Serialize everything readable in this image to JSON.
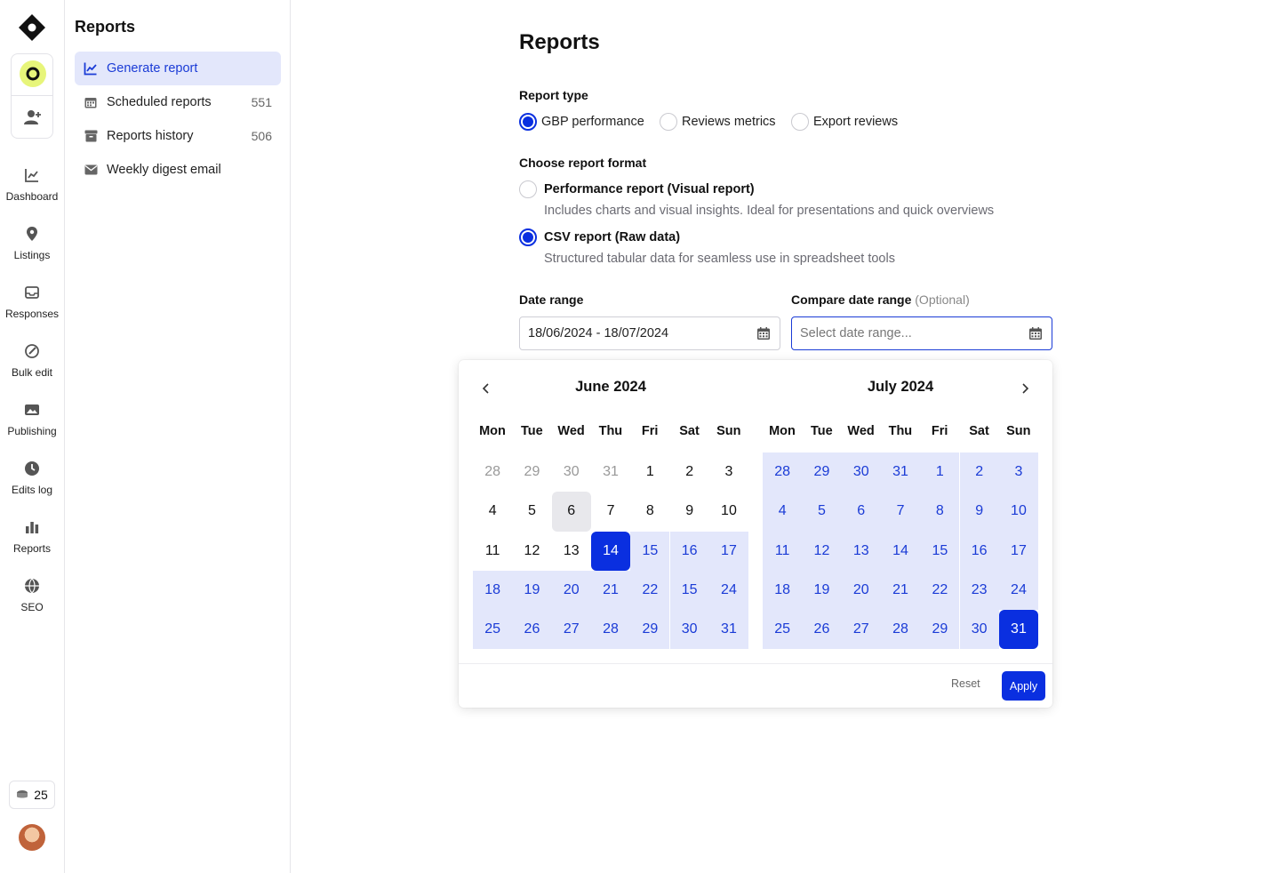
{
  "rail": {
    "items": [
      {
        "label": "Dashboard",
        "icon": "chart-line-icon"
      },
      {
        "label": "Listings",
        "icon": "map-pin-icon"
      },
      {
        "label": "Responses",
        "icon": "inbox-icon"
      },
      {
        "label": "Bulk edit",
        "icon": "bulk-edit-icon"
      },
      {
        "label": "Publishing",
        "icon": "images-icon"
      },
      {
        "label": "Edits log",
        "icon": "clock-icon"
      },
      {
        "label": "Reports",
        "icon": "bar-chart-icon"
      },
      {
        "label": "SEO",
        "icon": "globe-icon"
      }
    ],
    "credits": "25"
  },
  "subnav": {
    "title": "Reports",
    "items": [
      {
        "label": "Generate report",
        "count": "",
        "icon": "chart-line-icon"
      },
      {
        "label": "Scheduled reports",
        "count": "551",
        "icon": "calendar-icon"
      },
      {
        "label": "Reports history",
        "count": "506",
        "icon": "archive-icon"
      },
      {
        "label": "Weekly digest email",
        "count": "",
        "icon": "envelope-icon"
      }
    ]
  },
  "main": {
    "title": "Reports",
    "report_type_label": "Report type",
    "report_types": [
      "GBP performance",
      "Reviews metrics",
      "Export reviews"
    ],
    "selected_report_type": "GBP performance",
    "format_label": "Choose report format",
    "formats": [
      {
        "title": "Performance report (Visual report)",
        "desc": "Includes charts and visual insights. Ideal for presentations and quick overviews",
        "selected": false
      },
      {
        "title": "CSV report (Raw data)",
        "desc": "Structured tabular data for seamless use in spreadsheet tools",
        "selected": true
      }
    ],
    "date_range_label": "Date range",
    "date_range_value": "18/06/2024 - 18/07/2024",
    "compare_label": "Compare date range",
    "compare_optional": "(Optional)",
    "compare_placeholder": "Select date range..."
  },
  "calendar": {
    "weekdays": [
      "Mon",
      "Tue",
      "Wed",
      "Thu",
      "Fri",
      "Sat",
      "Sun"
    ],
    "months": [
      {
        "title": "June 2024",
        "days": [
          [
            "28",
            "29",
            "30",
            "31",
            "1",
            "2",
            "3"
          ],
          [
            "4",
            "5",
            "6",
            "7",
            "8",
            "9",
            "10"
          ],
          [
            "11",
            "12",
            "13",
            "14",
            "15",
            "16",
            "17"
          ],
          [
            "18",
            "19",
            "20",
            "21",
            "22",
            "15",
            "24"
          ],
          [
            "25",
            "26",
            "27",
            "28",
            "29",
            "30",
            "31"
          ]
        ],
        "states": [
          [
            "muted",
            "muted",
            "muted",
            "muted",
            "",
            "",
            ""
          ],
          [
            "",
            "",
            "today",
            "",
            "",
            "",
            ""
          ],
          [
            "",
            "",
            "",
            "sel",
            "inrange",
            "inrange",
            "inrange"
          ],
          [
            "inrange",
            "inrange",
            "inrange",
            "inrange",
            "inrange",
            "inrange",
            "inrange"
          ],
          [
            "inrange",
            "inrange",
            "inrange",
            "inrange",
            "inrange",
            "inrange",
            "inrange"
          ]
        ]
      },
      {
        "title": "July 2024",
        "days": [
          [
            "28",
            "29",
            "30",
            "31",
            "1",
            "2",
            "3"
          ],
          [
            "4",
            "5",
            "6",
            "7",
            "8",
            "9",
            "10"
          ],
          [
            "11",
            "12",
            "13",
            "14",
            "15",
            "16",
            "17"
          ],
          [
            "18",
            "19",
            "20",
            "21",
            "22",
            "23",
            "24"
          ],
          [
            "25",
            "26",
            "27",
            "28",
            "29",
            "30",
            "31"
          ]
        ],
        "states": [
          [
            "inrange",
            "inrange",
            "inrange",
            "inrange",
            "inrange",
            "inrange",
            "inrange"
          ],
          [
            "inrange",
            "inrange",
            "inrange",
            "inrange",
            "inrange",
            "inrange",
            "inrange"
          ],
          [
            "inrange",
            "inrange",
            "inrange",
            "inrange",
            "inrange",
            "inrange",
            "inrange"
          ],
          [
            "inrange",
            "inrange",
            "inrange",
            "inrange",
            "inrange",
            "inrange",
            "inrange"
          ],
          [
            "inrange",
            "inrange",
            "inrange",
            "inrange",
            "inrange",
            "inrange",
            "sel"
          ]
        ]
      }
    ],
    "reset_label": "Reset",
    "apply_label": "Apply"
  },
  "colors": {
    "accent": "#0a2fe0",
    "range": "#e3e7fb",
    "range_text": "#1a3bd6"
  }
}
